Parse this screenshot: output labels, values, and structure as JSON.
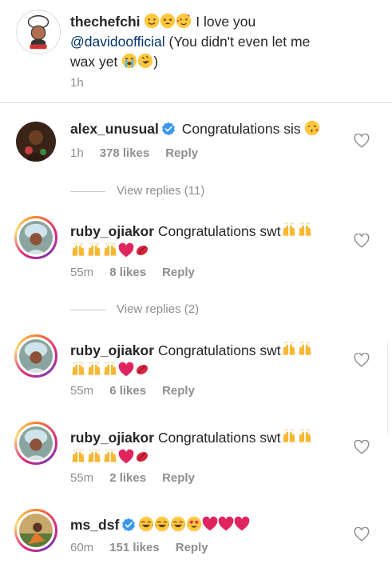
{
  "top_comment": {
    "username": "thechefchi",
    "line1_text": " I love you",
    "mention": "@davidoofficial",
    "line2_text": " (You didn't even let me",
    "line3_text": "wax yet ",
    "line3_end": ")",
    "time": "1h"
  },
  "comments": [
    {
      "username": "alex_unusual",
      "verified": true,
      "text": " Congratulations sis ",
      "time": "1h",
      "likes": "378 likes",
      "reply": "Reply",
      "view_replies": "View replies (11)"
    },
    {
      "username": "ruby_ojiakor",
      "verified": false,
      "text": " Congratulations swt",
      "time": "55m",
      "likes": "8 likes",
      "reply": "Reply",
      "view_replies": "View replies (2)"
    },
    {
      "username": "ruby_ojiakor",
      "verified": false,
      "text": " Congratulations swt",
      "time": "55m",
      "likes": "6 likes",
      "reply": "Reply"
    },
    {
      "username": "ruby_ojiakor",
      "verified": false,
      "text": " Congratulations swt",
      "time": "55m",
      "likes": "2 likes",
      "reply": "Reply"
    },
    {
      "username": "ms_dsf",
      "verified": true,
      "text": "",
      "time": "60m",
      "likes": "151 likes",
      "reply": "Reply"
    }
  ],
  "colors": {
    "username": "#262626",
    "meta": "#8e8e8e",
    "mention": "#003569",
    "verified": "#3897f0",
    "heart_emoji": "#e0245e"
  }
}
